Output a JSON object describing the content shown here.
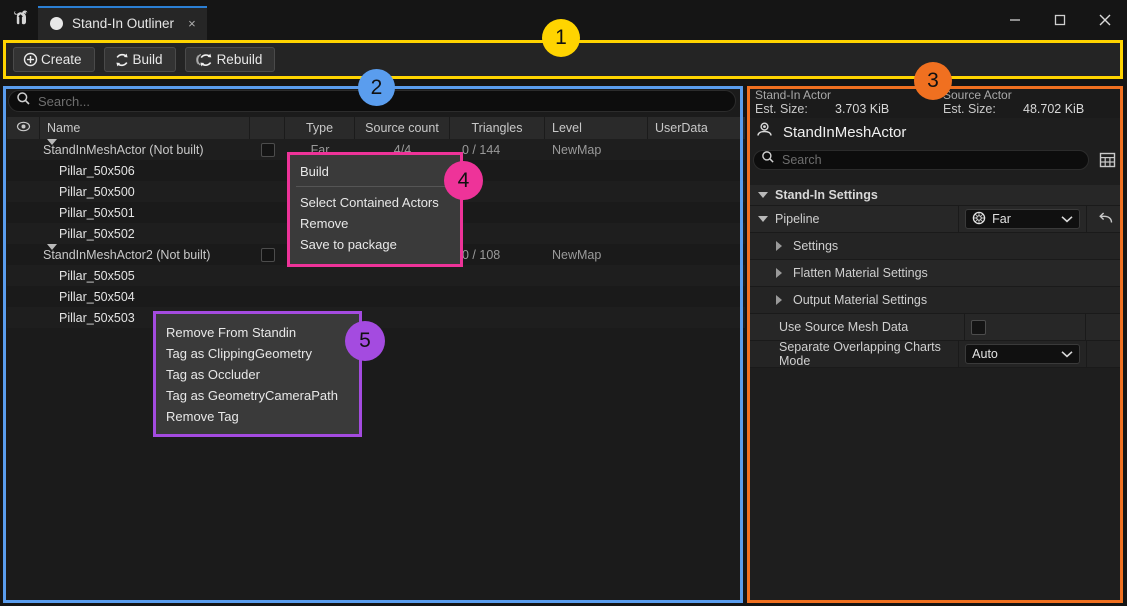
{
  "window": {
    "app_icon": "unreal-engine-logo",
    "tab": {
      "label": "Stand-In Outliner",
      "close": "×"
    },
    "controls": {
      "minimize": "minimize-icon",
      "maximize": "maximize-icon",
      "close": "close-icon"
    }
  },
  "toolbar": {
    "buttons": [
      {
        "label": "Create",
        "icon": "plus-circle-icon"
      },
      {
        "label": "Build",
        "icon": "refresh-icon"
      },
      {
        "label": "Rebuild",
        "icon": "refresh-all-icon"
      }
    ]
  },
  "outliner": {
    "search": {
      "placeholder": "Search...",
      "value": "",
      "icon": "search-icon"
    },
    "columns": [
      {
        "key": "eye",
        "label": "",
        "icon": "eye-icon"
      },
      {
        "key": "name",
        "label": "Name"
      },
      {
        "key": "blank",
        "label": ""
      },
      {
        "key": "type",
        "label": "Type"
      },
      {
        "key": "source",
        "label": "Source count"
      },
      {
        "key": "triangles",
        "label": "Triangles"
      },
      {
        "key": "level",
        "label": "Level"
      },
      {
        "key": "userdata",
        "label": "UserData"
      }
    ],
    "rows": [
      {
        "kind": "parent",
        "name": "StandInMeshActor (Not built)",
        "type": "Far",
        "source": "4/4",
        "triangles": "0 / 144",
        "level": "NewMap",
        "userdata": "",
        "checked": false
      },
      {
        "kind": "child",
        "name": "Pillar_50x506",
        "type": "",
        "source": "",
        "triangles": "",
        "level": "",
        "userdata": ""
      },
      {
        "kind": "child",
        "name": "Pillar_50x500",
        "type": "",
        "source": "",
        "triangles": "",
        "level": "",
        "userdata": ""
      },
      {
        "kind": "child",
        "name": "Pillar_50x501",
        "type": "",
        "source": "",
        "triangles": "",
        "level": "",
        "userdata": ""
      },
      {
        "kind": "child",
        "name": "Pillar_50x502",
        "type": "",
        "source": "",
        "triangles": "",
        "level": "",
        "userdata": ""
      },
      {
        "kind": "parent",
        "name": "StandInMeshActor2 (Not built)",
        "type": "",
        "source": "",
        "triangles": "0 / 108",
        "level": "NewMap",
        "userdata": "",
        "checked": false
      },
      {
        "kind": "child",
        "name": "Pillar_50x505",
        "type": "",
        "source": "",
        "triangles": "",
        "level": "",
        "userdata": ""
      },
      {
        "kind": "child",
        "name": "Pillar_50x504",
        "type": "",
        "source": "",
        "triangles": "",
        "level": "",
        "userdata": ""
      },
      {
        "kind": "child",
        "name": "Pillar_50x503",
        "type": "",
        "source": "",
        "triangles": "",
        "level": "",
        "userdata": ""
      }
    ]
  },
  "details": {
    "standin": {
      "title": "Stand-In Actor",
      "size_label": "Est. Size:",
      "size_value": "3.703 KiB"
    },
    "source": {
      "title": "Source Actor",
      "size_label": "Est. Size:",
      "size_value": "48.702 KiB"
    },
    "actor_name": "StandInMeshActor",
    "actor_icon": "actor-icon",
    "search": {
      "placeholder": "Search",
      "value": "",
      "icon": "search-icon"
    },
    "grid_icon": "grid-view-icon",
    "section_title": "Stand-In Settings",
    "pipeline": {
      "label": "Pipeline",
      "value": "Far",
      "icon": "pipeline-icon",
      "revert_icon": "revert-arrow-icon"
    },
    "sub_sections": [
      {
        "label": "Settings"
      },
      {
        "label": "Flatten Material Settings"
      },
      {
        "label": "Output Material Settings"
      }
    ],
    "use_source_mesh_data": {
      "label": "Use Source Mesh Data",
      "checked": false
    },
    "separate_charts": {
      "label": "Separate Overlapping Charts Mode",
      "value": "Auto"
    }
  },
  "context_menu_actor": {
    "items": [
      {
        "label": "Build"
      },
      {
        "separator": true
      },
      {
        "label": "Select Contained Actors"
      },
      {
        "label": "Remove"
      },
      {
        "label": "Save to package"
      }
    ]
  },
  "context_menu_child": {
    "items": [
      {
        "label": "Remove From Standin"
      },
      {
        "label": "Tag as ClippingGeometry"
      },
      {
        "label": "Tag as Occluder"
      },
      {
        "label": "Tag as GeometryCameraPath"
      },
      {
        "label": "Remove Tag"
      }
    ]
  },
  "annotations": [
    {
      "id": "1",
      "label": "1",
      "color": "#FFD400",
      "target": "toolbar"
    },
    {
      "id": "2",
      "label": "2",
      "color": "#5A9DEE",
      "target": "outliner-panel"
    },
    {
      "id": "3",
      "label": "3",
      "color": "#F07020",
      "target": "details-panel"
    },
    {
      "id": "4",
      "label": "4",
      "color": "#EE3399",
      "target": "context-menu-actor"
    },
    {
      "id": "5",
      "label": "5",
      "color": "#A44BE0",
      "target": "context-menu-child"
    }
  ]
}
